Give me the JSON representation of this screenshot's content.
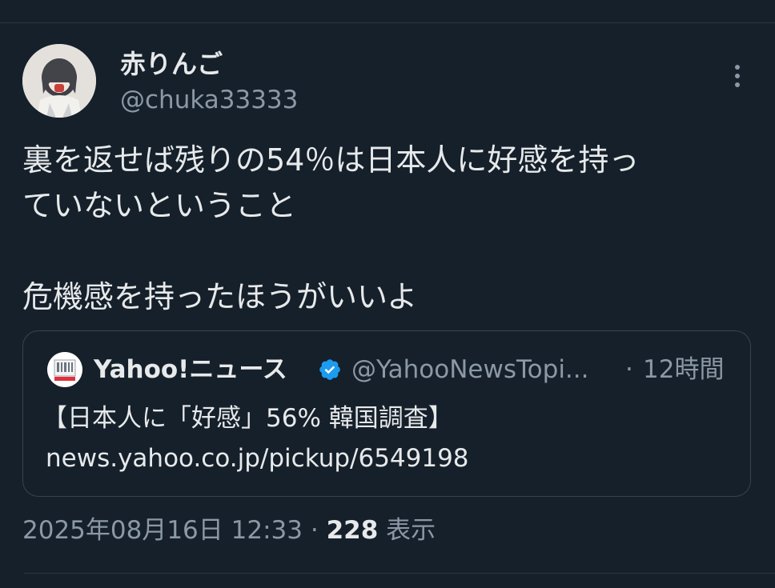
{
  "tweet": {
    "display_name": "赤りんご",
    "handle": "@chuka33333",
    "text_line1": "裏を返せば残りの54％は日本人に好感を持っ",
    "text_line2": "ていないということ",
    "text_line3": "危機感を持ったほうがいいよ",
    "timestamp": "2025年08月16日 12:33",
    "separator": "·",
    "views_count": "228",
    "views_label": "表示"
  },
  "quote": {
    "source_name": "Yahoo!ニュース",
    "source_handle": "@YahooNewsTopi...",
    "separator": "·",
    "time_ago": "12時間",
    "title": "【日本人に「好感」56% 韓国調査】",
    "link": "news.yahoo.co.jp/pickup/6549198"
  },
  "colors": {
    "background": "#15202b",
    "text_primary": "#e7e9ea",
    "text_secondary": "#8b98a5",
    "verified": "#1d9bf0",
    "border": "#38444d"
  },
  "icons": {
    "more": "more-vertical-icon",
    "verified": "verified-badge-icon"
  }
}
